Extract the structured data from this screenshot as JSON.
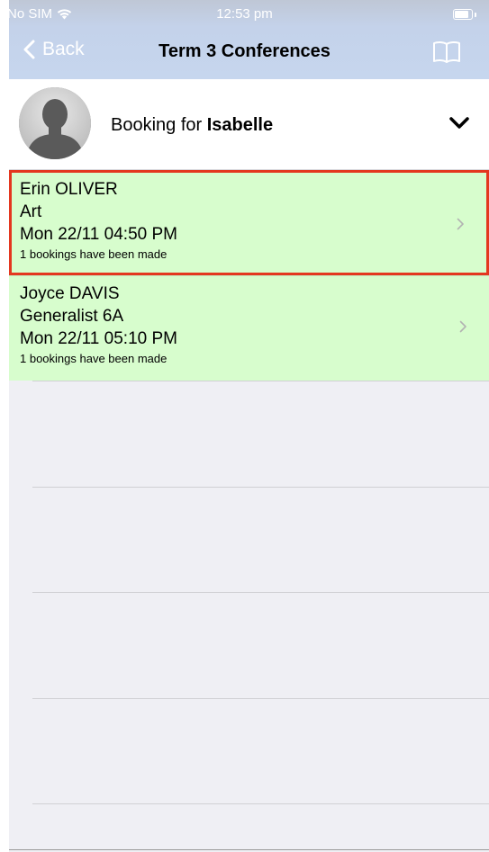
{
  "status_bar": {
    "carrier": "No SIM",
    "time": "12:53 pm"
  },
  "nav": {
    "back_label": "Back",
    "title": "Term 3 Conferences"
  },
  "booking": {
    "prefix": "Booking for",
    "student": "Isabelle"
  },
  "conferences": [
    {
      "teacher": "Erin OLIVER",
      "subject": "Art",
      "slot": "Mon 22/11 04:50 PM",
      "status": "1 bookings have been made"
    },
    {
      "teacher": "Joyce DAVIS",
      "subject": "Generalist 6A",
      "slot": "Mon 22/11 05:10 PM",
      "status": "1 bookings have been made"
    }
  ],
  "colors": {
    "nav_tint": "#c6d6ee",
    "row_background": "#d7fdcd",
    "selection_outline": "#e4371f",
    "list_background": "#efeff4"
  }
}
